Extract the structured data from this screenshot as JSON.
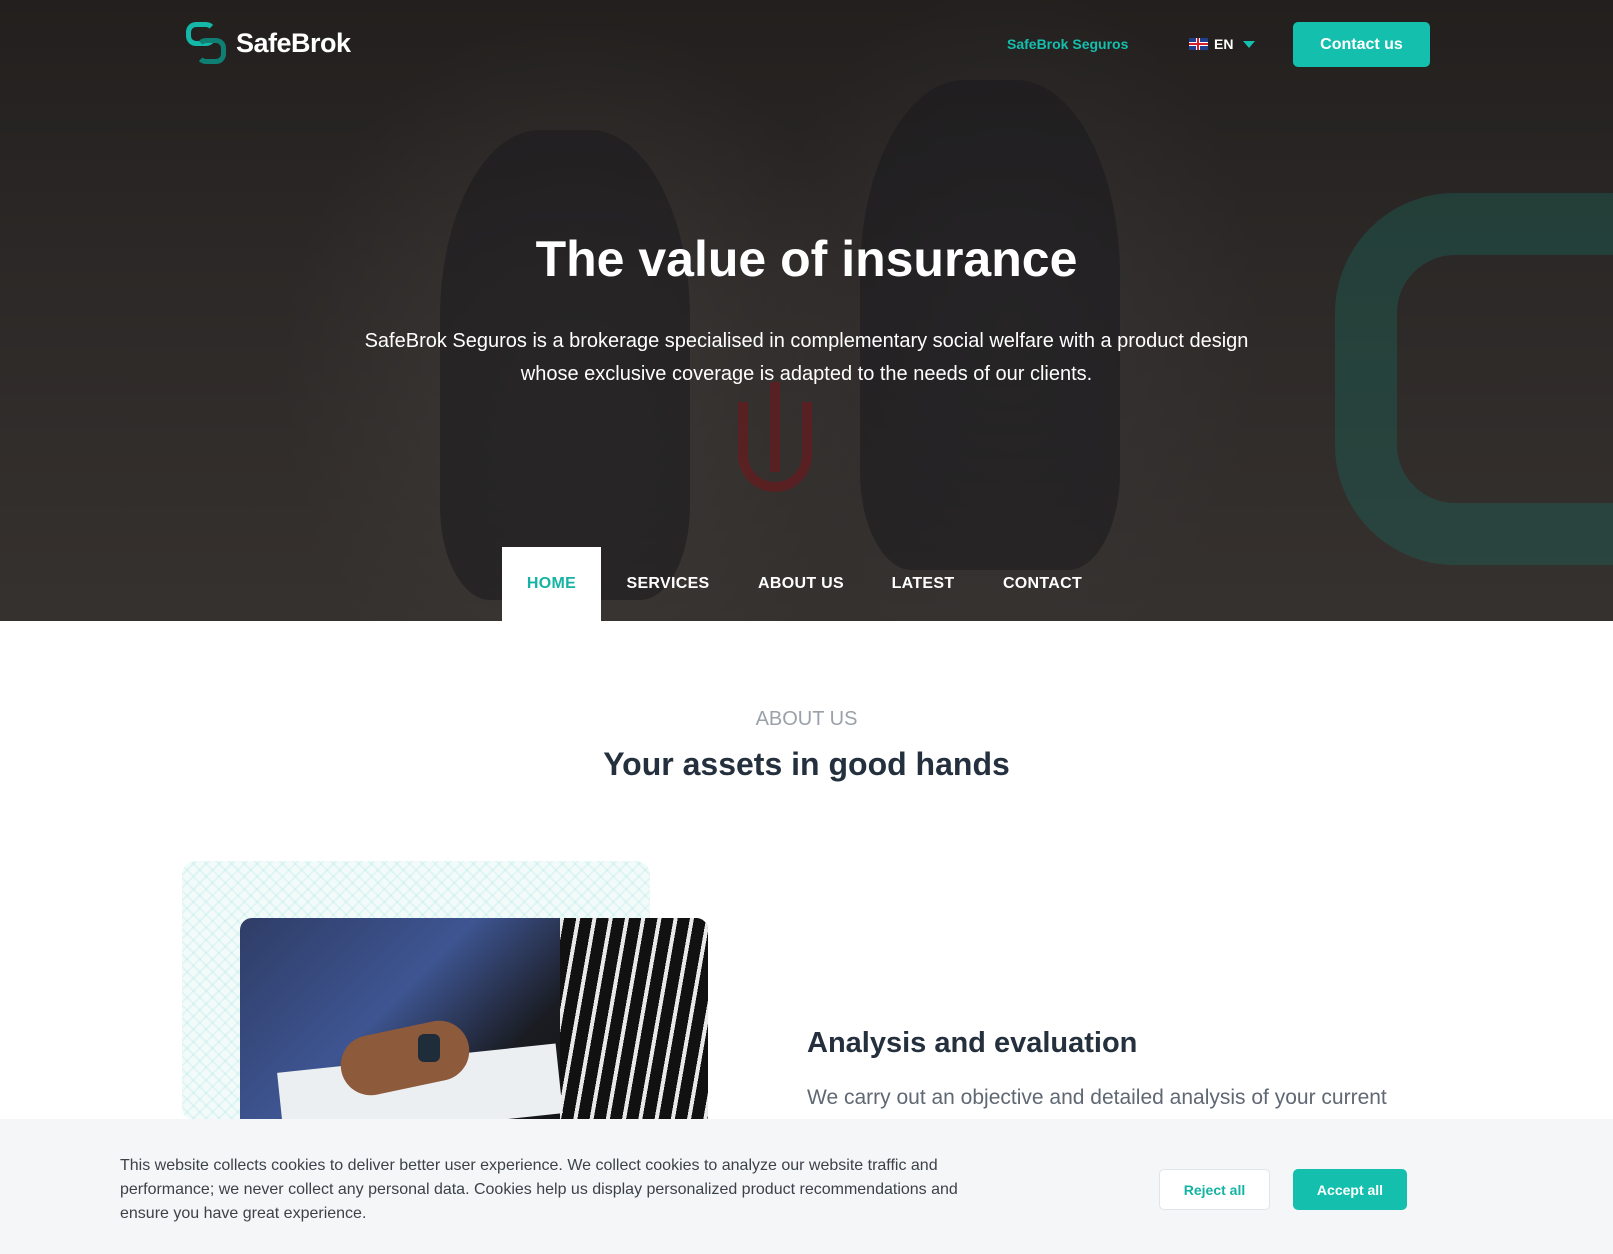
{
  "header": {
    "logo_text": "SafeBrok",
    "top_link": "SafeBrok Seguros",
    "language": "EN",
    "contact_button": "Contact us"
  },
  "hero": {
    "title": "The value of insurance",
    "subtitle": "SafeBrok Seguros is a brokerage specialised in complementary social welfare with a product design whose exclusive coverage is adapted to the needs of our clients."
  },
  "nav": {
    "items": [
      "HOME",
      "SERVICES",
      "ABOUT US",
      "LATEST",
      "CONTACT"
    ],
    "active": "HOME"
  },
  "about": {
    "eyebrow": "ABOUT US",
    "title": "Your assets in good hands",
    "card_title": "Analysis and evaluation",
    "card_text": "We carry out an objective and detailed analysis of your current"
  },
  "cookie_banner": {
    "text": "This website collects cookies to deliver better user experience. We collect cookies to analyze our website traffic and performance; we never collect any personal data. Cookies help us display personalized product recommendations and ensure you have great experience.",
    "reject_button": "Reject all",
    "accept_button": "Accept all"
  },
  "colors": {
    "accent": "#14c0ad",
    "heading": "#24303d",
    "muted": "#9ba1a9"
  },
  "icons": [
    "logo-mark-icon",
    "uk-flag-icon",
    "chevron-down-icon"
  ]
}
